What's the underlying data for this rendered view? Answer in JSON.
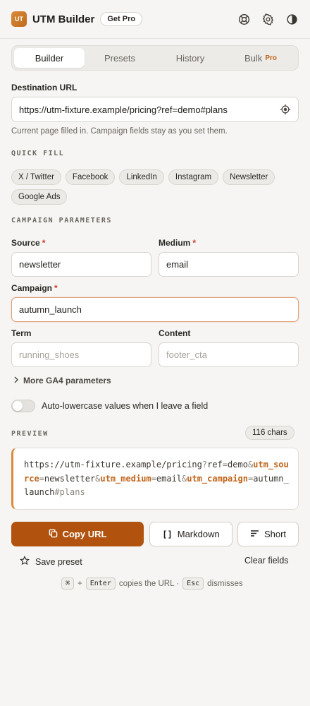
{
  "header": {
    "logo_text": "UT",
    "title": "UTM Builder",
    "pro_badge": "Get Pro",
    "icons": [
      "support-icon",
      "gear-icon",
      "contrast-icon"
    ]
  },
  "tabs": [
    {
      "label": "Builder",
      "active": true
    },
    {
      "label": "Presets"
    },
    {
      "label": "History"
    },
    {
      "label": "Bulk",
      "badge": "Pro"
    }
  ],
  "destination": {
    "label": "Destination URL",
    "value": "https://utm-fixture.example/pricing?ref=demo#plans",
    "hint": "Current page filled in. Campaign fields stay as you set them."
  },
  "quick_fill": {
    "title": "QUICK FILL",
    "chips": [
      "X / Twitter",
      "Facebook",
      "LinkedIn",
      "Instagram",
      "Newsletter",
      "Google Ads"
    ]
  },
  "campaign": {
    "title": "CAMPAIGN PARAMETERS",
    "required_marker": "*",
    "source": {
      "label": "Source",
      "value": "newsletter"
    },
    "medium": {
      "label": "Medium",
      "value": "email"
    },
    "campaign": {
      "label": "Campaign",
      "value": "autumn_launch"
    },
    "term": {
      "label": "Term",
      "placeholder": "running_shoes"
    },
    "content": {
      "label": "Content",
      "placeholder": "footer_cta"
    },
    "more": "More GA4 parameters",
    "auto_lowercase": "Auto-lowercase values when I leave a field",
    "auto_lowercase_on": false
  },
  "preview": {
    "title": "PREVIEW",
    "count": "116 chars",
    "parts": {
      "base": "https://utm-fixture.example/pricing",
      "q": "?",
      "ref_key": "ref",
      "eq1": "=",
      "ref_val": "demo",
      "amp1": "&",
      "k1": "utm_source",
      "eq2": "=",
      "v1": "newsletter",
      "amp2": "&",
      "k2": "utm_medium",
      "eq3": "=",
      "v2": "email",
      "amp3": "&",
      "k3": "utm_campaign",
      "eq4": "=",
      "v3": "autumn_launch",
      "hash": "#plans"
    }
  },
  "actions": {
    "copy": "Copy URL",
    "markdown": "Markdown",
    "short": "Short",
    "save_preset": "Save preset",
    "clear": "Clear fields"
  },
  "shortcut": {
    "key1": "⌘",
    "plus": "+",
    "key2": "Enter",
    "text1": "copies the URL ·",
    "key3": "Esc",
    "text2": "dismisses"
  },
  "colors": {
    "accent": "#b1520f",
    "required": "#d0382b"
  }
}
